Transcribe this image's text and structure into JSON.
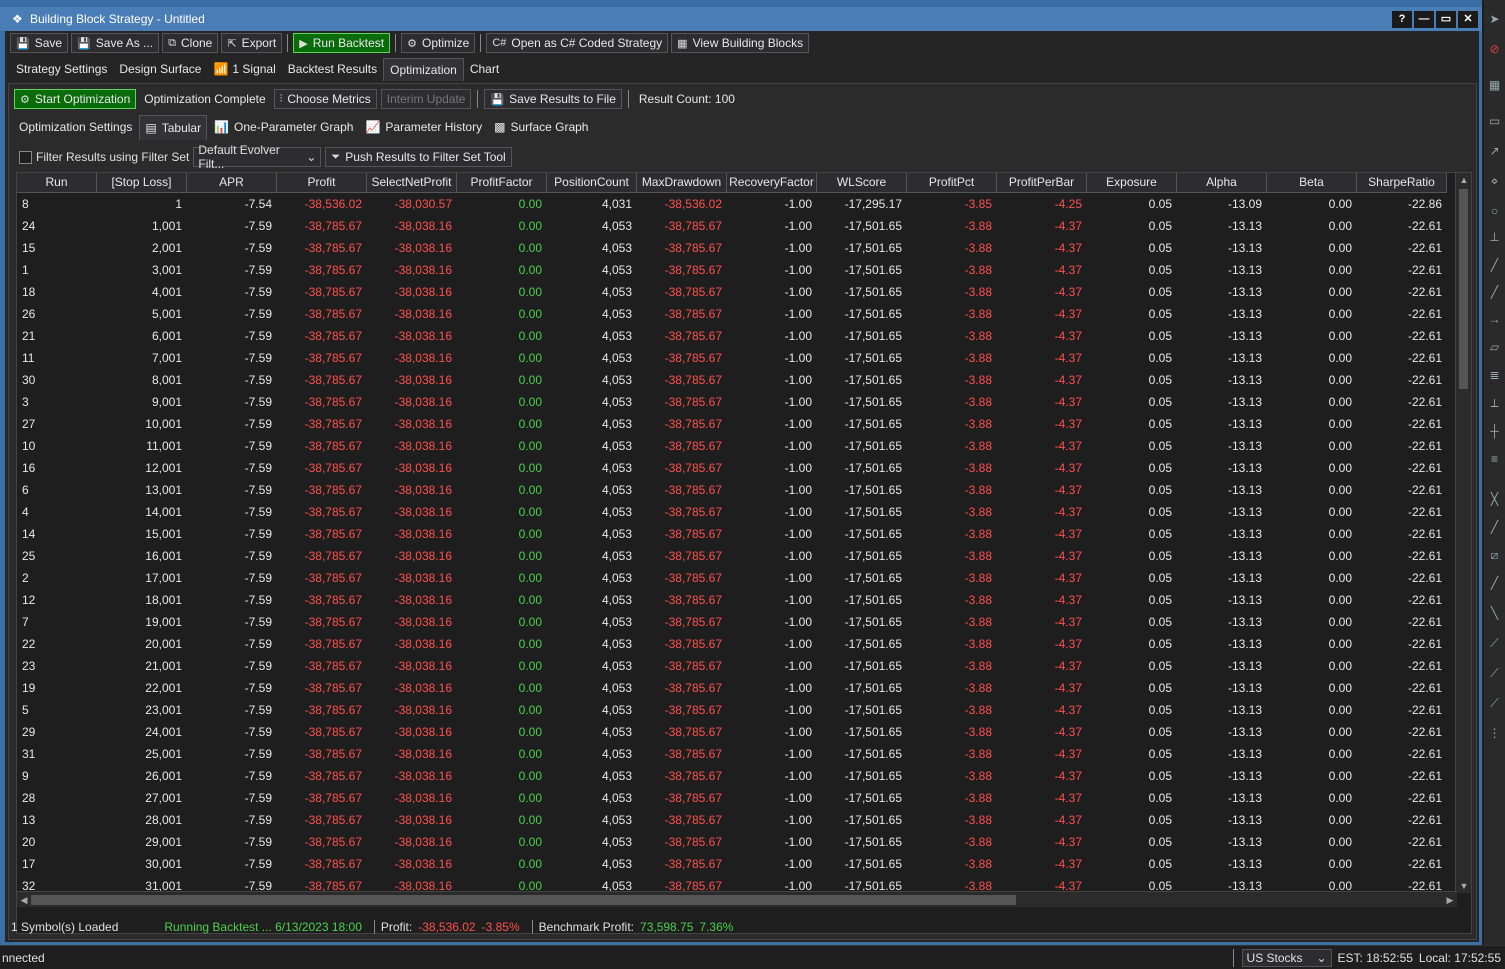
{
  "window": {
    "title": "Building Block Strategy - Untitled",
    "help": "?",
    "min": "—",
    "max": "▭",
    "close": "✕"
  },
  "toolbar": {
    "save": "Save",
    "save_as": "Save As ...",
    "clone": "Clone",
    "export": "Export",
    "run_backtest": "Run Backtest",
    "optimize": "Optimize",
    "open_csharp": "Open as C# Coded Strategy",
    "view_blocks": "View Building Blocks"
  },
  "main_tabs": [
    "Strategy Settings",
    "Design Surface",
    "1 Signal",
    "Backtest Results",
    "Optimization",
    "Chart"
  ],
  "opt_toolbar": {
    "start": "Start Optimization",
    "status": "Optimization Complete",
    "choose_metrics": "Choose Metrics",
    "interim": "Interim Update",
    "save_results": "Save Results to File",
    "result_count": "Result Count: 100"
  },
  "sub_tabs": [
    "Optimization Settings",
    "Tabular",
    "One-Parameter Graph",
    "Parameter History",
    "Surface Graph"
  ],
  "filter": {
    "label": "Filter Results using Filter Set",
    "filter_set": "Default Evolver Filt...",
    "push": "Push Results to Filter Set Tool"
  },
  "grid": {
    "columns": [
      "Run",
      "[Stop Loss]",
      "APR",
      "Profit",
      "SelectNetProfit",
      "ProfitFactor",
      "PositionCount",
      "MaxDrawdown",
      "RecoveryFactor",
      "WLScore",
      "ProfitPct",
      "ProfitPerBar",
      "Exposure",
      "Alpha",
      "Beta",
      "SharpeRatio"
    ],
    "rows": [
      [
        "8",
        "1",
        "-7.54",
        "-38,536.02",
        "-38,030.57",
        "0.00",
        "4,031",
        "-38,536.02",
        "-1.00",
        "-17,295.17",
        "-3.85",
        "-4.25",
        "0.05",
        "-13.09",
        "0.00",
        "-22.86"
      ],
      [
        "24",
        "1,001",
        "-7.59",
        "-38,785.67",
        "-38,038.16",
        "0.00",
        "4,053",
        "-38,785.67",
        "-1.00",
        "-17,501.65",
        "-3.88",
        "-4.37",
        "0.05",
        "-13.13",
        "0.00",
        "-22.61"
      ],
      [
        "15",
        "2,001",
        "-7.59",
        "-38,785.67",
        "-38,038.16",
        "0.00",
        "4,053",
        "-38,785.67",
        "-1.00",
        "-17,501.65",
        "-3.88",
        "-4.37",
        "0.05",
        "-13.13",
        "0.00",
        "-22.61"
      ],
      [
        "1",
        "3,001",
        "-7.59",
        "-38,785.67",
        "-38,038.16",
        "0.00",
        "4,053",
        "-38,785.67",
        "-1.00",
        "-17,501.65",
        "-3.88",
        "-4.37",
        "0.05",
        "-13.13",
        "0.00",
        "-22.61"
      ],
      [
        "18",
        "4,001",
        "-7.59",
        "-38,785.67",
        "-38,038.16",
        "0.00",
        "4,053",
        "-38,785.67",
        "-1.00",
        "-17,501.65",
        "-3.88",
        "-4.37",
        "0.05",
        "-13.13",
        "0.00",
        "-22.61"
      ],
      [
        "26",
        "5,001",
        "-7.59",
        "-38,785.67",
        "-38,038.16",
        "0.00",
        "4,053",
        "-38,785.67",
        "-1.00",
        "-17,501.65",
        "-3.88",
        "-4.37",
        "0.05",
        "-13.13",
        "0.00",
        "-22.61"
      ],
      [
        "21",
        "6,001",
        "-7.59",
        "-38,785.67",
        "-38,038.16",
        "0.00",
        "4,053",
        "-38,785.67",
        "-1.00",
        "-17,501.65",
        "-3.88",
        "-4.37",
        "0.05",
        "-13.13",
        "0.00",
        "-22.61"
      ],
      [
        "11",
        "7,001",
        "-7.59",
        "-38,785.67",
        "-38,038.16",
        "0.00",
        "4,053",
        "-38,785.67",
        "-1.00",
        "-17,501.65",
        "-3.88",
        "-4.37",
        "0.05",
        "-13.13",
        "0.00",
        "-22.61"
      ],
      [
        "30",
        "8,001",
        "-7.59",
        "-38,785.67",
        "-38,038.16",
        "0.00",
        "4,053",
        "-38,785.67",
        "-1.00",
        "-17,501.65",
        "-3.88",
        "-4.37",
        "0.05",
        "-13.13",
        "0.00",
        "-22.61"
      ],
      [
        "3",
        "9,001",
        "-7.59",
        "-38,785.67",
        "-38,038.16",
        "0.00",
        "4,053",
        "-38,785.67",
        "-1.00",
        "-17,501.65",
        "-3.88",
        "-4.37",
        "0.05",
        "-13.13",
        "0.00",
        "-22.61"
      ],
      [
        "27",
        "10,001",
        "-7.59",
        "-38,785.67",
        "-38,038.16",
        "0.00",
        "4,053",
        "-38,785.67",
        "-1.00",
        "-17,501.65",
        "-3.88",
        "-4.37",
        "0.05",
        "-13.13",
        "0.00",
        "-22.61"
      ],
      [
        "10",
        "11,001",
        "-7.59",
        "-38,785.67",
        "-38,038.16",
        "0.00",
        "4,053",
        "-38,785.67",
        "-1.00",
        "-17,501.65",
        "-3.88",
        "-4.37",
        "0.05",
        "-13.13",
        "0.00",
        "-22.61"
      ],
      [
        "16",
        "12,001",
        "-7.59",
        "-38,785.67",
        "-38,038.16",
        "0.00",
        "4,053",
        "-38,785.67",
        "-1.00",
        "-17,501.65",
        "-3.88",
        "-4.37",
        "0.05",
        "-13.13",
        "0.00",
        "-22.61"
      ],
      [
        "6",
        "13,001",
        "-7.59",
        "-38,785.67",
        "-38,038.16",
        "0.00",
        "4,053",
        "-38,785.67",
        "-1.00",
        "-17,501.65",
        "-3.88",
        "-4.37",
        "0.05",
        "-13.13",
        "0.00",
        "-22.61"
      ],
      [
        "4",
        "14,001",
        "-7.59",
        "-38,785.67",
        "-38,038.16",
        "0.00",
        "4,053",
        "-38,785.67",
        "-1.00",
        "-17,501.65",
        "-3.88",
        "-4.37",
        "0.05",
        "-13.13",
        "0.00",
        "-22.61"
      ],
      [
        "14",
        "15,001",
        "-7.59",
        "-38,785.67",
        "-38,038.16",
        "0.00",
        "4,053",
        "-38,785.67",
        "-1.00",
        "-17,501.65",
        "-3.88",
        "-4.37",
        "0.05",
        "-13.13",
        "0.00",
        "-22.61"
      ],
      [
        "25",
        "16,001",
        "-7.59",
        "-38,785.67",
        "-38,038.16",
        "0.00",
        "4,053",
        "-38,785.67",
        "-1.00",
        "-17,501.65",
        "-3.88",
        "-4.37",
        "0.05",
        "-13.13",
        "0.00",
        "-22.61"
      ],
      [
        "2",
        "17,001",
        "-7.59",
        "-38,785.67",
        "-38,038.16",
        "0.00",
        "4,053",
        "-38,785.67",
        "-1.00",
        "-17,501.65",
        "-3.88",
        "-4.37",
        "0.05",
        "-13.13",
        "0.00",
        "-22.61"
      ],
      [
        "12",
        "18,001",
        "-7.59",
        "-38,785.67",
        "-38,038.16",
        "0.00",
        "4,053",
        "-38,785.67",
        "-1.00",
        "-17,501.65",
        "-3.88",
        "-4.37",
        "0.05",
        "-13.13",
        "0.00",
        "-22.61"
      ],
      [
        "7",
        "19,001",
        "-7.59",
        "-38,785.67",
        "-38,038.16",
        "0.00",
        "4,053",
        "-38,785.67",
        "-1.00",
        "-17,501.65",
        "-3.88",
        "-4.37",
        "0.05",
        "-13.13",
        "0.00",
        "-22.61"
      ],
      [
        "22",
        "20,001",
        "-7.59",
        "-38,785.67",
        "-38,038.16",
        "0.00",
        "4,053",
        "-38,785.67",
        "-1.00",
        "-17,501.65",
        "-3.88",
        "-4.37",
        "0.05",
        "-13.13",
        "0.00",
        "-22.61"
      ],
      [
        "23",
        "21,001",
        "-7.59",
        "-38,785.67",
        "-38,038.16",
        "0.00",
        "4,053",
        "-38,785.67",
        "-1.00",
        "-17,501.65",
        "-3.88",
        "-4.37",
        "0.05",
        "-13.13",
        "0.00",
        "-22.61"
      ],
      [
        "19",
        "22,001",
        "-7.59",
        "-38,785.67",
        "-38,038.16",
        "0.00",
        "4,053",
        "-38,785.67",
        "-1.00",
        "-17,501.65",
        "-3.88",
        "-4.37",
        "0.05",
        "-13.13",
        "0.00",
        "-22.61"
      ],
      [
        "5",
        "23,001",
        "-7.59",
        "-38,785.67",
        "-38,038.16",
        "0.00",
        "4,053",
        "-38,785.67",
        "-1.00",
        "-17,501.65",
        "-3.88",
        "-4.37",
        "0.05",
        "-13.13",
        "0.00",
        "-22.61"
      ],
      [
        "29",
        "24,001",
        "-7.59",
        "-38,785.67",
        "-38,038.16",
        "0.00",
        "4,053",
        "-38,785.67",
        "-1.00",
        "-17,501.65",
        "-3.88",
        "-4.37",
        "0.05",
        "-13.13",
        "0.00",
        "-22.61"
      ],
      [
        "31",
        "25,001",
        "-7.59",
        "-38,785.67",
        "-38,038.16",
        "0.00",
        "4,053",
        "-38,785.67",
        "-1.00",
        "-17,501.65",
        "-3.88",
        "-4.37",
        "0.05",
        "-13.13",
        "0.00",
        "-22.61"
      ],
      [
        "9",
        "26,001",
        "-7.59",
        "-38,785.67",
        "-38,038.16",
        "0.00",
        "4,053",
        "-38,785.67",
        "-1.00",
        "-17,501.65",
        "-3.88",
        "-4.37",
        "0.05",
        "-13.13",
        "0.00",
        "-22.61"
      ],
      [
        "28",
        "27,001",
        "-7.59",
        "-38,785.67",
        "-38,038.16",
        "0.00",
        "4,053",
        "-38,785.67",
        "-1.00",
        "-17,501.65",
        "-3.88",
        "-4.37",
        "0.05",
        "-13.13",
        "0.00",
        "-22.61"
      ],
      [
        "13",
        "28,001",
        "-7.59",
        "-38,785.67",
        "-38,038.16",
        "0.00",
        "4,053",
        "-38,785.67",
        "-1.00",
        "-17,501.65",
        "-3.88",
        "-4.37",
        "0.05",
        "-13.13",
        "0.00",
        "-22.61"
      ],
      [
        "20",
        "29,001",
        "-7.59",
        "-38,785.67",
        "-38,038.16",
        "0.00",
        "4,053",
        "-38,785.67",
        "-1.00",
        "-17,501.65",
        "-3.88",
        "-4.37",
        "0.05",
        "-13.13",
        "0.00",
        "-22.61"
      ],
      [
        "17",
        "30,001",
        "-7.59",
        "-38,785.67",
        "-38,038.16",
        "0.00",
        "4,053",
        "-38,785.67",
        "-1.00",
        "-17,501.65",
        "-3.88",
        "-4.37",
        "0.05",
        "-13.13",
        "0.00",
        "-22.61"
      ],
      [
        "32",
        "31,001",
        "-7.59",
        "-38,785.67",
        "-38,038.16",
        "0.00",
        "4,053",
        "-38,785.67",
        "-1.00",
        "-17,501.65",
        "-3.88",
        "-4.37",
        "0.05",
        "-13.13",
        "0.00",
        "-22.61"
      ]
    ]
  },
  "status": {
    "symbols": "1 Symbol(s) Loaded",
    "running": "Running Backtest ... 6/13/2023 18:00",
    "profit_label": "Profit:",
    "profit_value": "-38,536.02",
    "profit_pct": "-3.85%",
    "bench_label": "Benchmark Profit:",
    "bench_value": "73,598.75",
    "bench_pct": "7.36%"
  },
  "appstatus": {
    "connection": "nnected",
    "market": "US Stocks",
    "est": "EST: 18:52:55",
    "local": "Local: 17:52:55"
  },
  "colors": {
    "negative": "#ff5050",
    "positive": "#4cd04c",
    "accent_button": "#0a6b0a",
    "title_bar": "#4a7db5"
  }
}
